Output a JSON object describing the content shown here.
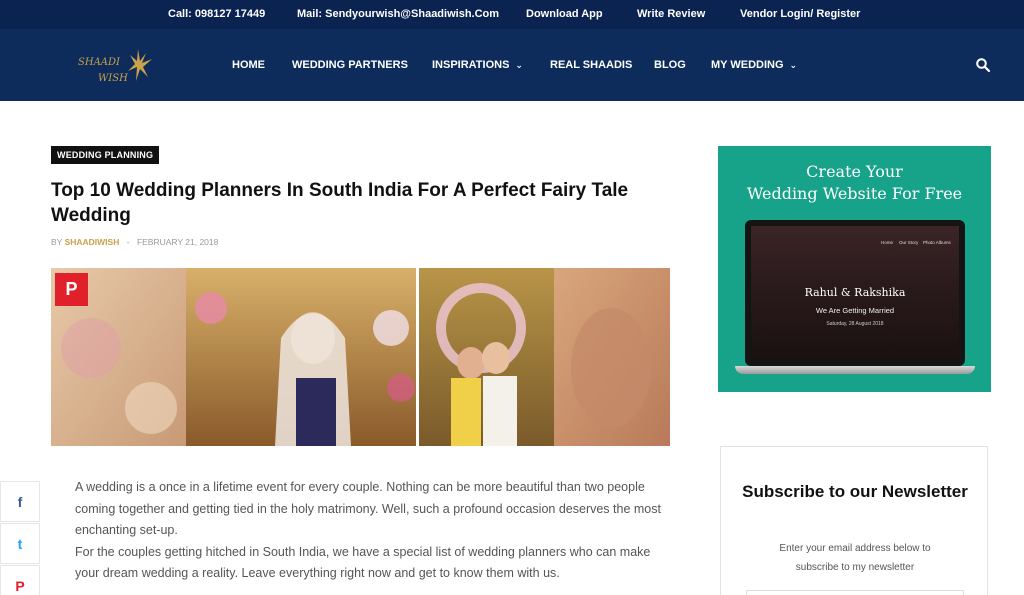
{
  "topbar": {
    "call": "Call: 098127 17449",
    "mail": "Mail: Sendyourwish@Shaadiwish.Com",
    "download": "Download App",
    "review": "Write Review",
    "vendor": "Vendor Login/ Register"
  },
  "brand": {
    "line1": "SHAADI",
    "line2": "WISH",
    "color": "#c9a24a"
  },
  "nav": {
    "home": "HOME",
    "partners": "WEDDING PARTNERS",
    "inspirations": "INSPIRATIONS",
    "real": "REAL SHAADIS",
    "blog": "BLOG",
    "mywedding": "MY WEDDING"
  },
  "article": {
    "category": "WEDDING PLANNING",
    "title": "Top 10 Wedding Planners In South India For A Perfect Fairy Tale Wedding",
    "by": "BY",
    "author": "SHAADIWISH",
    "sep": "-",
    "date": "FEBRUARY 21, 2018",
    "pin": "P",
    "p1": "A wedding is a once in a lifetime event for every couple. Nothing can be more beautiful than two people coming together and getting tied in the holy matrimony. Well, such a profound occasion deserves the most enchanting set-up.",
    "p2": "For the couples getting hitched in South India, we have a special list of wedding planners who can make your dream wedding a reality. Leave everything right now and get to know them with us."
  },
  "share": {
    "facebook": "f",
    "twitter": "t",
    "pinterest": "P"
  },
  "ad": {
    "line1": "Create Your",
    "line2": "Wedding Website For Free",
    "nav_home": "Home",
    "nav_story": "Our Story",
    "nav_albums": "Photo Albums",
    "couple": "Rahul & Rakshika",
    "tagline": "We Are Getting Married",
    "date": "Saturday, 28 August 2018"
  },
  "newsletter": {
    "title": "Subscribe to our Newsletter",
    "desc_line1": "Enter your email address below to",
    "desc_line2": "subscribe to my newsletter"
  },
  "colors": {
    "topbar": "#0a2350",
    "navbar": "#0d2c5c",
    "accent": "#c9a24a",
    "ad_bg": "#17a389",
    "pin": "#e0202a"
  }
}
